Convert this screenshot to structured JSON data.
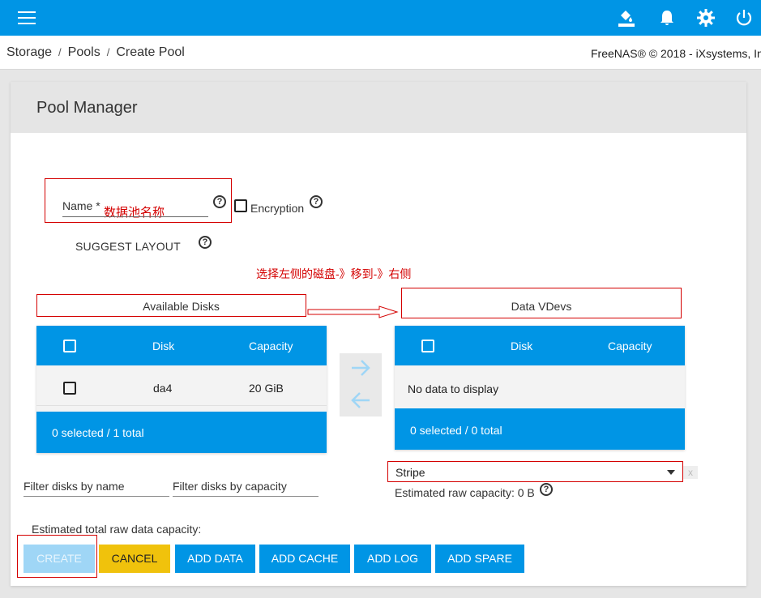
{
  "topbar": {
    "menu_icon": "hamburger-menu-icon",
    "icons": [
      "theme-bucket-icon",
      "bell-icon",
      "gear-icon",
      "power-icon"
    ],
    "color": "#0095e5"
  },
  "breadcrumb": {
    "items": [
      "Storage",
      "Pools",
      "Create Pool"
    ],
    "separator": "/"
  },
  "copyright": "FreeNAS® © 2018 - iXsystems, In",
  "card": {
    "title": "Pool Manager"
  },
  "name_field": {
    "label": "Name *",
    "annotation": "数据池名称"
  },
  "encryption": {
    "label": "Encryption"
  },
  "suggest_layout": "SUGGEST LAYOUT",
  "annotation_hint": "选择左侧的磁盘-》移到-》右侧",
  "available": {
    "title": "Available Disks",
    "columns": [
      "Disk",
      "Capacity"
    ],
    "rows": [
      {
        "disk": "da4",
        "capacity": "20 GiB"
      }
    ],
    "footer": "0 selected / 1 total"
  },
  "vdevs": {
    "title": "Data VDevs",
    "columns": [
      "Disk",
      "Capacity"
    ],
    "empty": "No data to display",
    "footer": "0 selected / 0 total"
  },
  "vdev_type": {
    "value": "Stripe",
    "clear": "x"
  },
  "estimated_raw": "Estimated raw capacity: 0 B",
  "filters": {
    "name_placeholder": "Filter disks by name",
    "capacity_placeholder": "Filter disks by capacity"
  },
  "estimated_total": "Estimated total raw data capacity:",
  "buttons": {
    "create": "CREATE",
    "cancel": "CANCEL",
    "add_data": "ADD DATA",
    "add_cache": "ADD CACHE",
    "add_log": "ADD LOG",
    "add_spare": "ADD SPARE"
  },
  "colors": {
    "accent": "#0095e5",
    "cancel": "#f0c20c",
    "annotation": "#d40000"
  }
}
